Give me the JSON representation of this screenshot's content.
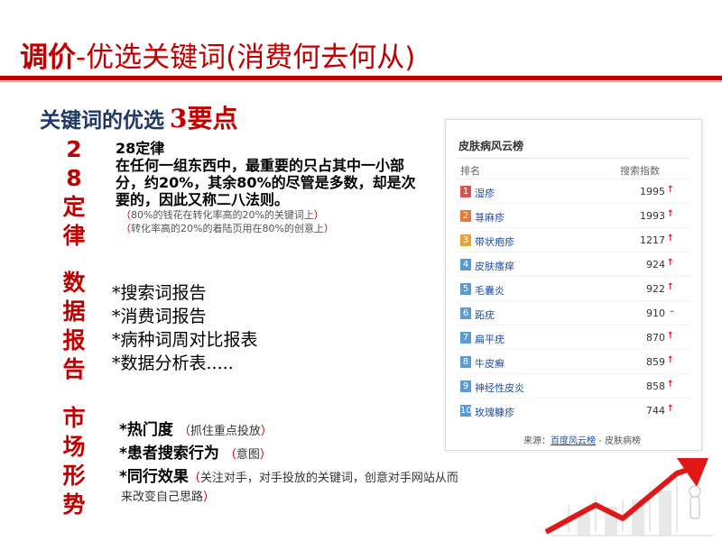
{
  "title": {
    "highlight": "调价",
    "rest": "-优选关键词(消费何去何从)"
  },
  "subtitle": {
    "text": "关键词的优选",
    "num": "3",
    "suffix": "要点"
  },
  "side_labels": {
    "rule": [
      "2",
      "8",
      "定",
      "律"
    ],
    "data": [
      "数",
      "据",
      "报",
      "告"
    ],
    "market": [
      "市",
      "场",
      "形",
      "势"
    ]
  },
  "rule": {
    "title": "28定律",
    "lines": [
      "在任何一组东西中，最重要的只占其中一小部",
      "分，约20%，其余80%的尽管是多数，却是次",
      "要的，因此又称二八法则。"
    ],
    "notes": [
      "80%的钱花在转化率高的20%的关键词上",
      "转化率高的20%的着陆页用在80%的创意上"
    ]
  },
  "data_reports": [
    "*搜索词报告",
    "*消费词报告",
    "*病种词周对比报表",
    "*数据分析表....."
  ],
  "market": {
    "item1": {
      "label": "*热门度",
      "note": "抓住重点投放"
    },
    "item2": {
      "label": "*患者搜索行为",
      "note": "意图"
    },
    "item3": {
      "label": "*同行效果",
      "note": "关注对手，对手投放的关键词，创意对手网站从而",
      "note2": "来改变自己思路"
    }
  },
  "card": {
    "title": "皮肤病风云榜",
    "col_rank": "排名",
    "col_index": "搜索指数",
    "rows": [
      {
        "rank": "1",
        "keyword": "湿疹",
        "value": "1995",
        "trend": "up"
      },
      {
        "rank": "2",
        "keyword": "荨麻疹",
        "value": "1993",
        "trend": "up"
      },
      {
        "rank": "3",
        "keyword": "带状疱疹",
        "value": "1217",
        "trend": "up"
      },
      {
        "rank": "4",
        "keyword": "皮肤瘙痒",
        "value": "924",
        "trend": "up"
      },
      {
        "rank": "5",
        "keyword": "毛囊炎",
        "value": "922",
        "trend": "up"
      },
      {
        "rank": "6",
        "keyword": "跖疣",
        "value": "910",
        "trend": "flat"
      },
      {
        "rank": "7",
        "keyword": "扁平疣",
        "value": "870",
        "trend": "up"
      },
      {
        "rank": "8",
        "keyword": "牛皮癣",
        "value": "859",
        "trend": "up"
      },
      {
        "rank": "9",
        "keyword": "神经性皮炎",
        "value": "858",
        "trend": "up"
      },
      {
        "rank": "10",
        "keyword": "玫瑰糠疹",
        "value": "744",
        "trend": "up"
      }
    ],
    "source_prefix": "来源：",
    "source_link": "百度风云榜",
    "source_suffix": " - 皮肤病榜"
  },
  "colors": {
    "accent": "#c00000",
    "top_rank": "#d9534f",
    "rank": "#5b9bd5",
    "up": "#e02020",
    "flat": "#4a90d9"
  },
  "arrows": {
    "up": "↑",
    "flat": "–"
  },
  "paren_open": "（",
  "paren_close": "）"
}
